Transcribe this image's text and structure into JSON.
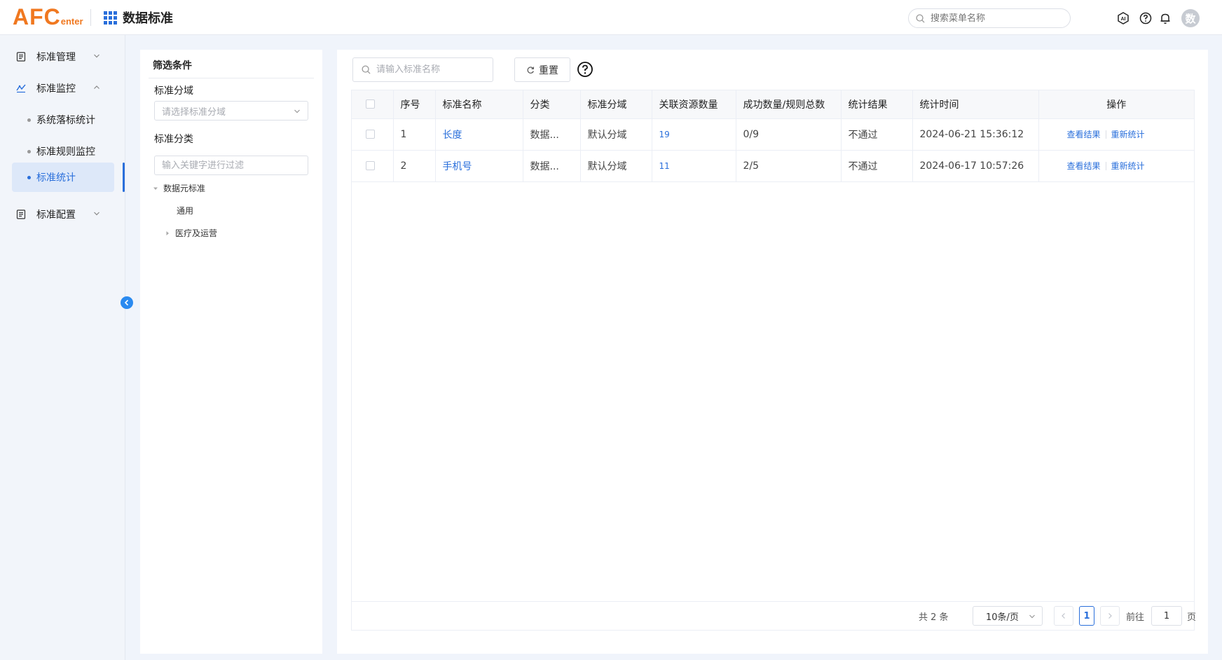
{
  "header": {
    "logo_big": "AFC",
    "logo_small": "enter",
    "app_title": "数据标准",
    "menu_search_placeholder": "搜索菜单名称",
    "avatar_text": "数"
  },
  "sidebar": {
    "items": [
      {
        "label": "标准管理"
      },
      {
        "label": "标准监控"
      },
      {
        "label": "系统落标统计"
      },
      {
        "label": "标准规则监控"
      },
      {
        "label": "标准统计"
      },
      {
        "label": "标准配置"
      }
    ]
  },
  "filter": {
    "title": "筛选条件",
    "domain_label": "标准分域",
    "domain_placeholder": "请选择标准分域",
    "category_label": "标准分类",
    "keyword_placeholder": "输入关键字进行过滤",
    "tree": [
      {
        "label": "数据元标准"
      },
      {
        "label": "通用"
      },
      {
        "label": "医疗及运营"
      }
    ]
  },
  "toolbar": {
    "search_placeholder": "请输入标准名称",
    "reset_label": "重置"
  },
  "table": {
    "columns": [
      "序号",
      "标准名称",
      "分类",
      "标准分域",
      "关联资源数量",
      "成功数量/规则总数",
      "统计结果",
      "统计时间",
      "操作"
    ],
    "rows": [
      {
        "index": "1",
        "name": "长度",
        "category": "数据...",
        "domain": "默认分域",
        "resources": "19",
        "ratio": "0/9",
        "result": "不通过",
        "time": "2024-06-21 15:36:12",
        "op_view": "查看结果",
        "op_rerun": "重新统计"
      },
      {
        "index": "2",
        "name": "手机号",
        "category": "数据...",
        "domain": "默认分域",
        "resources": "11",
        "ratio": "2/5",
        "result": "不通过",
        "time": "2024-06-17 10:57:26",
        "op_view": "查看结果",
        "op_rerun": "重新统计"
      }
    ]
  },
  "pagination": {
    "total": "共 2 条",
    "page_size": "10条/页",
    "current_page": "1",
    "goto_label": "前往",
    "goto_value": "1",
    "page_suffix": "页"
  },
  "colors": {
    "accent": "#2a6fdb",
    "logo": "#f07820"
  }
}
